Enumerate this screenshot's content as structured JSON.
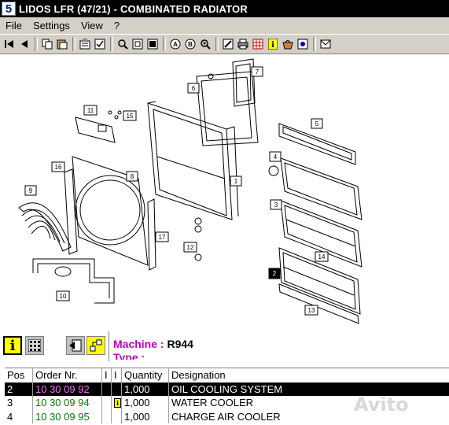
{
  "window": {
    "app_icon_glyph": "5",
    "title": "LIDOS LFR (47/21) - COMBINATED RADIATOR"
  },
  "menu": {
    "items": [
      "File",
      "Settings",
      "View",
      "?"
    ]
  },
  "toolbar": {
    "icons": [
      "first-icon",
      "prev-icon",
      "copy-icon",
      "paste-icon",
      "notes-icon",
      "checklist-icon",
      "zoom-icon",
      "zoom-fit-icon",
      "zoom-page-icon",
      "find-icon",
      "find-next-icon",
      "search-part-icon",
      "edit-icon",
      "print-icon",
      "grid-icon",
      "info-icon",
      "basket-icon",
      "hotspot-icon",
      "mail-icon"
    ]
  },
  "drawing": {
    "callouts": [
      "1",
      "2",
      "3",
      "4",
      "5",
      "6",
      "7",
      "8",
      "9",
      "10",
      "11",
      "12",
      "13",
      "14",
      "15",
      "16",
      "17"
    ],
    "selected_callout": "2"
  },
  "panel": {
    "info_glyph": "i",
    "machine_label": "Machine :",
    "machine_value": "R944",
    "type_label": "Type :"
  },
  "parts_table": {
    "headers": [
      "Pos",
      "Order Nr.",
      "I",
      "I",
      "Quantity",
      "Designation"
    ],
    "rows": [
      {
        "pos": "2",
        "order": "10 30 09 92",
        "info": "",
        "qty": "1,000",
        "designation": "OIL COOLING SYSTEM",
        "selected": true
      },
      {
        "pos": "3",
        "order": "10 30 09 94",
        "info": "i",
        "qty": "1,000",
        "designation": "WATER COOLER",
        "selected": false
      },
      {
        "pos": "4",
        "order": "10 30 09 95",
        "info": "",
        "qty": "1,000",
        "designation": "CHARGE AIR COOLER",
        "selected": false
      }
    ]
  },
  "watermark": "Avito",
  "colors": {
    "selection_bg": "#000000",
    "order_selected": "#ff66ff",
    "order_normal": "#008000",
    "machine_label": "#c000c0",
    "info_yellow": "#ffff00"
  }
}
